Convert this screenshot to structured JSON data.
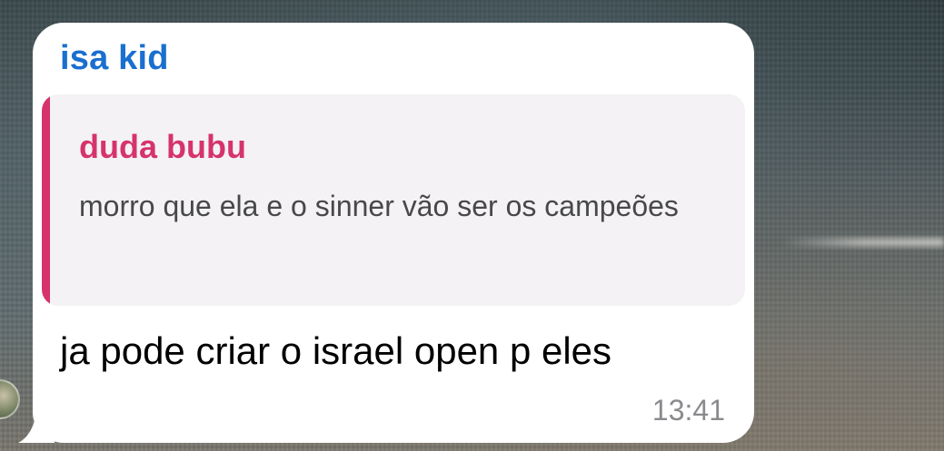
{
  "message": {
    "sender": "isa kid",
    "reply": {
      "author": "duda bubu",
      "text": "morro que ela e o sinner vão ser os campeões"
    },
    "text": "ja pode criar o israel open p eles",
    "time": "13:41"
  },
  "colors": {
    "sender_name": "#1a6fcf",
    "reply_accent": "#d6336c",
    "bubble": "#ffffff",
    "quote_background": "#f4f2f4",
    "timestamp": "#8a8a8e"
  }
}
